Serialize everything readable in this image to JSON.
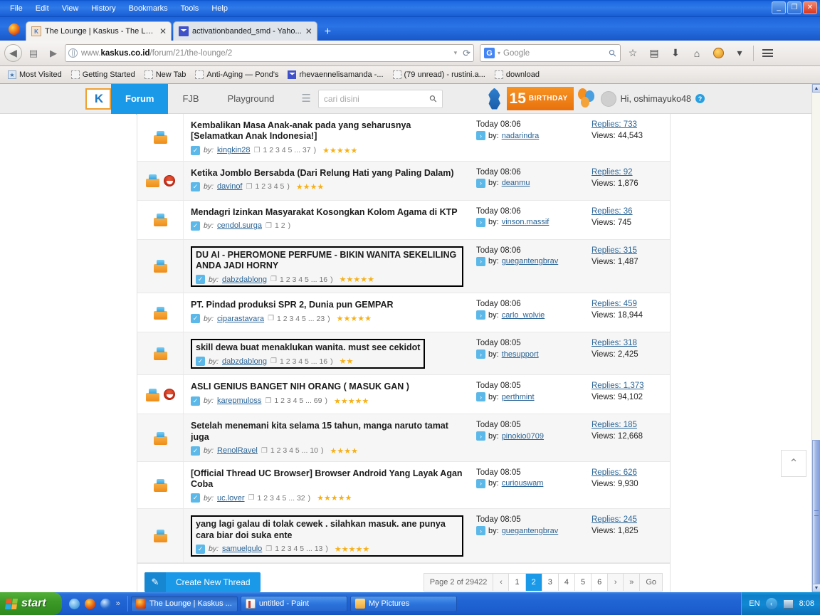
{
  "window": {
    "menus": [
      "File",
      "Edit",
      "View",
      "History",
      "Bookmarks",
      "Tools",
      "Help"
    ],
    "controls": {
      "minimize": "_",
      "maximize": "❐",
      "close": "✕"
    }
  },
  "tabs": [
    {
      "title": "The Lounge | Kaskus - The La...",
      "favicon": "kaskus-favicon",
      "active": true,
      "close": "✕"
    },
    {
      "title": "activationbanded_smd - Yaho...",
      "favicon": "yahoo-mail-favicon",
      "active": false,
      "close": "✕"
    }
  ],
  "newtab_label": "+",
  "toolbar": {
    "back": "◀",
    "forward": "▶",
    "url_prefix": "www.",
    "url_domain": "kaskus.co.id",
    "url_path": "/forum/21/the-lounge/2",
    "url_dropdown": "▾",
    "reload": "⟳",
    "search_engine": "G",
    "search_caret": "▾",
    "search_placeholder": "Google",
    "bookmark_star": "☆",
    "reader": "▤",
    "download": "⬇",
    "home": "⌂",
    "addon": "smiley-addon",
    "overflow_caret": "▾",
    "menu": "☰"
  },
  "bookmarks": [
    {
      "label": "Most Visited",
      "icon": "star-folder-icon"
    },
    {
      "label": "Getting Started",
      "icon": "blank-icon"
    },
    {
      "label": "New Tab",
      "icon": "blank-icon"
    },
    {
      "label": "Anti-Aging — Pond's",
      "icon": "blank-icon"
    },
    {
      "label": "rhevaennelisamanda -...",
      "icon": "mail-icon"
    },
    {
      "label": "(79 unread) - rustini.a...",
      "icon": "blank-icon"
    },
    {
      "label": "download",
      "icon": "blank-icon"
    }
  ],
  "site": {
    "logo": "K",
    "nav": [
      {
        "label": "Forum",
        "active": true
      },
      {
        "label": "FJB",
        "active": false
      },
      {
        "label": "Playground",
        "active": false
      }
    ],
    "search_placeholder": "cari disini",
    "birthday_number": "15",
    "birthday_text": "BIRTHDAY",
    "greeting": "Hi, oshimayuko48",
    "help": "?"
  },
  "threads": [
    {
      "title": "Kembalikan Masa Anak-anak pada yang seharusnya [Selamatkan Anak Indonesia!]",
      "author": "kingkin28",
      "pages": "1  2  3  4  5 ... 37",
      "stars": 5,
      "icons": [
        "hot-thread-icon"
      ],
      "selected": false,
      "last_time": "Today 08:06",
      "last_author": "nadarindra",
      "replies": "Replies: 733",
      "views": "Views: 44,543"
    },
    {
      "title": "Ketika Jomblo Bersabda (Dari Relung Hati yang Paling Dalam)",
      "author": "davinof",
      "pages": "1  2  3  4  5",
      "stars": 4,
      "icons": [
        "hot-thread-icon",
        "lol-smiley-icon"
      ],
      "selected": false,
      "last_time": "Today 08:06",
      "last_author": "deanmu",
      "replies": "Replies: 92",
      "views": "Views: 1,876"
    },
    {
      "title": "Mendagri Izinkan Masyarakat Kosongkan Kolom Agama di KTP",
      "author": "cendol.surga",
      "pages": "1  2",
      "stars": 0,
      "icons": [
        "hot-thread-icon"
      ],
      "selected": false,
      "last_time": "Today 08:06",
      "last_author": "vinson.massif",
      "replies": "Replies: 36",
      "views": "Views: 745"
    },
    {
      "title": "DU AI - PHEROMONE PERFUME - BIKIN WANITA SEKELILING ANDA JADI HORNY",
      "author": "dabzdablong",
      "pages": "1  2  3  4  5 ... 16",
      "stars": 5,
      "icons": [
        "hot-thread-icon"
      ],
      "selected": true,
      "last_time": "Today 08:06",
      "last_author": "guegantengbrav",
      "replies": "Replies: 315",
      "views": "Views: 1,487"
    },
    {
      "title": "PT. Pindad produksi SPR 2, Dunia pun GEMPAR",
      "author": "ciparastavara",
      "pages": "1  2  3  4  5 ... 23",
      "stars": 5,
      "icons": [
        "hot-thread-icon"
      ],
      "selected": false,
      "last_time": "Today 08:06",
      "last_author": "carlo_wolvie",
      "replies": "Replies: 459",
      "views": "Views: 18,944"
    },
    {
      "title": "skill dewa buat menaklukan wanita. must see cekidot",
      "author": "dabzdablong",
      "pages": "1  2  3  4  5 ... 16",
      "stars": 2,
      "icons": [
        "hot-thread-icon"
      ],
      "selected": true,
      "last_time": "Today 08:05",
      "last_author": "thesupport",
      "replies": "Replies: 318",
      "views": "Views: 2,425"
    },
    {
      "title": "ASLI GENIUS BANGET NIH ORANG ( MASUK GAN )",
      "author": "karepmuloss",
      "pages": "1  2  3  4  5 ... 69",
      "stars": 5,
      "icons": [
        "hot-thread-icon",
        "lol-smiley-icon"
      ],
      "selected": false,
      "last_time": "Today 08:05",
      "last_author": "perthmint",
      "replies": "Replies: 1,373",
      "views": "Views: 94,102"
    },
    {
      "title": "Setelah menemani kita selama 15 tahun, manga naruto tamat juga",
      "author": "RenolRavel",
      "pages": "1  2  3  4  5 ... 10",
      "stars": 4,
      "icons": [
        "hot-thread-icon"
      ],
      "selected": false,
      "last_time": "Today 08:05",
      "last_author": "pinokio0709",
      "replies": "Replies: 185",
      "views": "Views: 12,668"
    },
    {
      "title": "[Official Thread UC Browser] Browser Android Yang Layak Agan Coba",
      "author": "uc.lover",
      "pages": "1  2  3  4  5 ... 32",
      "stars": 5,
      "icons": [
        "hot-thread-icon"
      ],
      "selected": false,
      "last_time": "Today 08:05",
      "last_author": "curiouswam",
      "replies": "Replies: 626",
      "views": "Views: 9,930"
    },
    {
      "title": "yang lagi galau di tolak cewek . silahkan masuk. ane punya cara biar doi suka ente",
      "author": "samuelgulo",
      "pages": "1  2  3  4  5 ... 13",
      "stars": 5,
      "icons": [
        "hot-thread-icon"
      ],
      "selected": true,
      "last_time": "Today 08:05",
      "last_author": "guegantengbrav",
      "replies": "Replies: 245",
      "views": "Views: 1,825"
    }
  ],
  "footer": {
    "create_thread_label": "Create New Thread",
    "page_info": "Page 2 of 29422",
    "prev": "‹",
    "next": "›",
    "last": "»",
    "go": "Go",
    "pages": [
      "1",
      "2",
      "3",
      "4",
      "5",
      "6"
    ],
    "current_page": "2"
  },
  "scroll_to_top": "⌃",
  "taskbar": {
    "start_label": "start",
    "quicklaunch_overflow": "»",
    "buttons": [
      {
        "label": "The Lounge | Kaskus ...",
        "icon": "firefox-icon",
        "active": true
      },
      {
        "label": "untitled - Paint",
        "icon": "paint-icon",
        "active": false
      },
      {
        "label": "My Pictures",
        "icon": "folder-icon",
        "active": false
      }
    ],
    "language": "EN",
    "clock": "8:08"
  }
}
